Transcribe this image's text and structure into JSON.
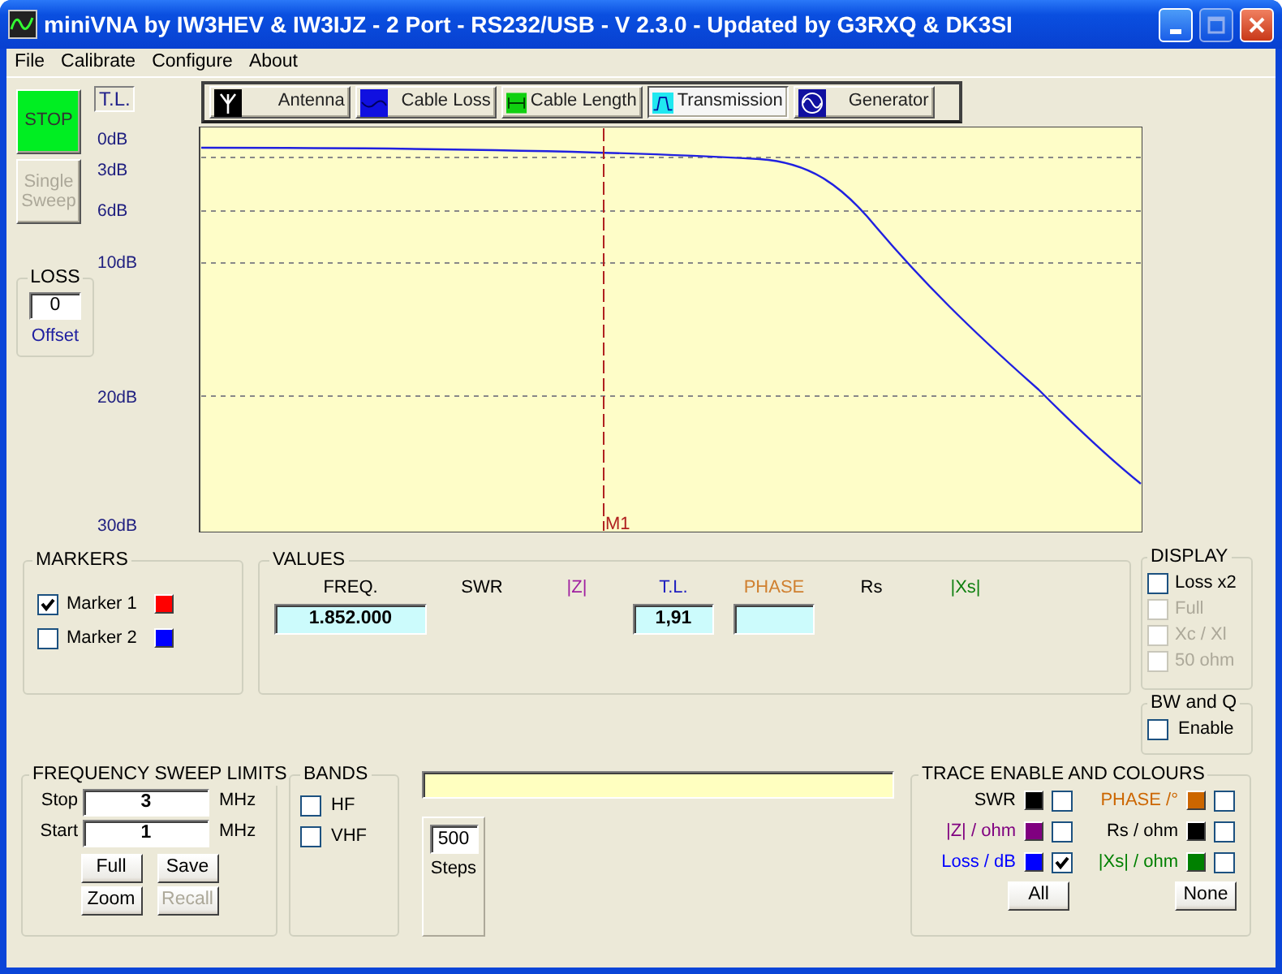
{
  "window": {
    "title": "miniVNA by IW3HEV & IW3IJZ - 2 Port - RS232/USB - V 2.3.0 - Updated by G3RXQ & DK3SI"
  },
  "menu": [
    "File",
    "Calibrate",
    "Configure",
    "About"
  ],
  "sweep_buttons": [
    {
      "label": "STOP",
      "kind": "stop",
      "disabled": false
    },
    {
      "label": "Single Sweep",
      "kind": "plain",
      "disabled": true
    }
  ],
  "loss": {
    "title": "LOSS",
    "value": "0",
    "caption": "Offset"
  },
  "mode_label": "T.L.",
  "tabs": [
    {
      "label": "Antenna",
      "kind": "antenna",
      "selected": false
    },
    {
      "label": "Cable Loss",
      "kind": "loss",
      "selected": false
    },
    {
      "label": "Cable Length",
      "kind": "length",
      "selected": false
    },
    {
      "label": "Transmission",
      "kind": "transmission",
      "selected": true
    },
    {
      "label": "Generator",
      "kind": "generator",
      "selected": false
    }
  ],
  "chart": {
    "y_labels": [
      "0dB",
      "3dB",
      "6dB",
      "10dB",
      "20dB",
      "30dB"
    ],
    "marker_label": "M1"
  },
  "markers": {
    "title": "MARKERS",
    "items": [
      {
        "label": "Marker 1",
        "checked": true,
        "color": "#ff0000"
      },
      {
        "label": "Marker 2",
        "checked": false,
        "color": "#0000ff"
      }
    ]
  },
  "values": {
    "title": "VALUES",
    "columns": [
      {
        "label": "FREQ.",
        "color": "#000000",
        "kind": "field",
        "value": "1.852.000"
      },
      {
        "label": "SWR",
        "color": "#000000",
        "kind": "plain"
      },
      {
        "label": "|Z|",
        "color": "#a020a0",
        "kind": "plain"
      },
      {
        "label": "T.L.",
        "color": "#2020c0",
        "kind": "field",
        "value": "1,91"
      },
      {
        "label": "PHASE",
        "color": "#d08030",
        "kind": "field"
      },
      {
        "label": "Rs",
        "color": "#000000",
        "kind": "plain"
      },
      {
        "label": "|Xs|",
        "color": "#108010",
        "kind": "plain"
      }
    ]
  },
  "display": {
    "title": "DISPLAY",
    "options": [
      {
        "label": "Loss x2",
        "checked": false,
        "disabled": false
      },
      {
        "label": "Full",
        "checked": false,
        "disabled": true
      },
      {
        "label": "Xc / Xl",
        "checked": false,
        "disabled": true
      },
      {
        "label": "50 ohm",
        "checked": false,
        "disabled": true
      }
    ]
  },
  "bw_and_q": {
    "title": "BW and Q",
    "option": {
      "label": "Enable",
      "checked": false
    }
  },
  "sweep_limits": {
    "title": "FREQUENCY SWEEP LIMITS",
    "fields": [
      {
        "label": "Stop",
        "value": "3",
        "unit": "MHz"
      },
      {
        "label": "Start",
        "value": "1",
        "unit": "MHz"
      }
    ],
    "buttons": [
      {
        "label": "Full",
        "disabled": false
      },
      {
        "label": "Save",
        "disabled": false
      },
      {
        "label": "Zoom",
        "disabled": false
      },
      {
        "label": "Recall",
        "disabled": true
      }
    ]
  },
  "bands": {
    "title": "BANDS",
    "options": [
      {
        "label": "HF",
        "checked": false
      },
      {
        "label": "VHF",
        "checked": false
      }
    ]
  },
  "steps": {
    "value": "500",
    "caption": "Steps"
  },
  "traces": {
    "title": "TRACE ENABLE AND COLOURS",
    "items": [
      {
        "label": "SWR",
        "color": "#000000",
        "checked": false
      },
      {
        "label": "PHASE /°",
        "color": "#cc6600",
        "checked": false
      },
      {
        "label": "|Z| / ohm",
        "color": "#800080",
        "checked": false
      },
      {
        "label": "Rs / ohm",
        "color": "#000000",
        "checked": false
      },
      {
        "label": "Loss / dB",
        "color": "#0000ff",
        "checked": true
      },
      {
        "label": "|Xs| / ohm",
        "color": "#008000",
        "checked": false
      }
    ],
    "buttons": [
      "All",
      "None"
    ]
  }
}
